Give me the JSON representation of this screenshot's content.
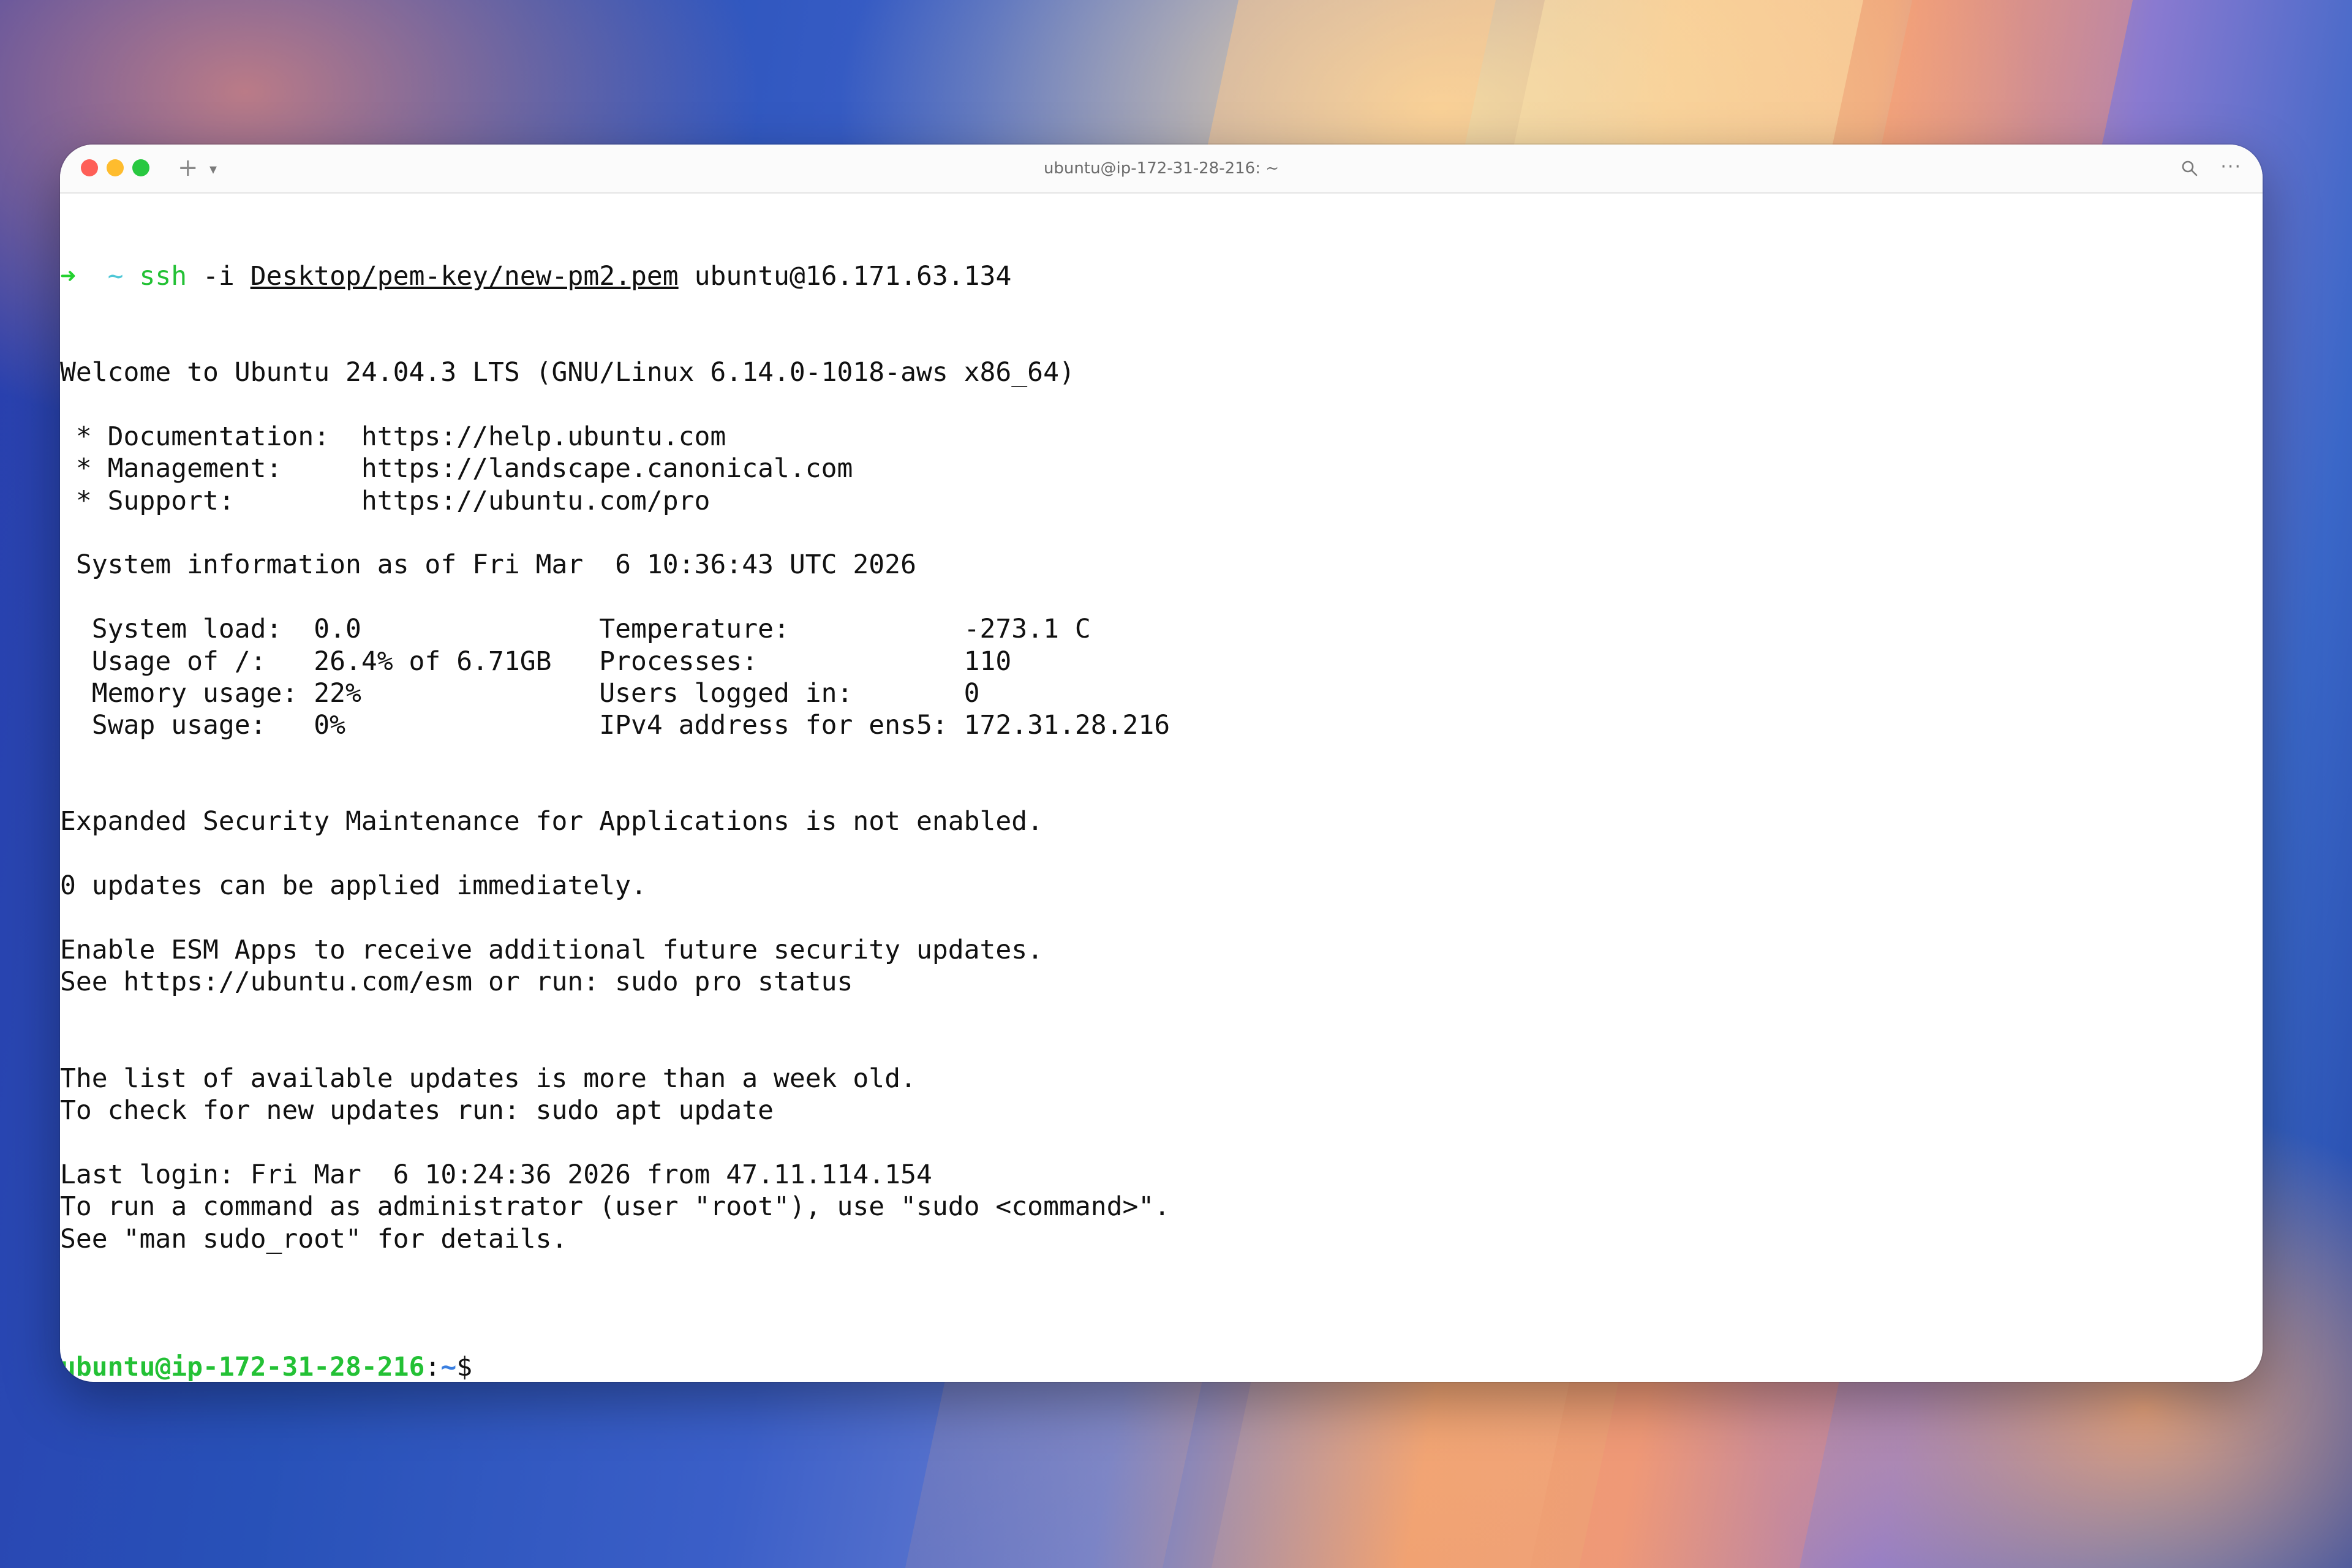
{
  "window": {
    "title": "ubuntu@ip-172-31-28-216: ~",
    "tab_add_glyph": "+",
    "tab_menu_glyph": "▾",
    "more_glyph": "···"
  },
  "icons": {
    "search": "search-icon",
    "more": "more-icon"
  },
  "colors": {
    "prompt_green": "#23c135",
    "path_blue": "#3a7fe0",
    "arrow_green": "#23d12f",
    "tilde_cyan": "#4fc7d6"
  },
  "terminal": {
    "command": {
      "arrow": "➜",
      "dir": "~",
      "program": "ssh",
      "flag": "-i",
      "key_path": "Desktop/pem-key/new-pm2.pem",
      "target": "ubuntu@16.171.63.134"
    },
    "lines": [
      "Welcome to Ubuntu 24.04.3 LTS (GNU/Linux 6.14.0-1018-aws x86_64)",
      "",
      " * Documentation:  https://help.ubuntu.com",
      " * Management:     https://landscape.canonical.com",
      " * Support:        https://ubuntu.com/pro",
      "",
      " System information as of Fri Mar  6 10:36:43 UTC 2026",
      "",
      "  System load:  0.0               Temperature:           -273.1 C",
      "  Usage of /:   26.4% of 6.71GB   Processes:             110",
      "  Memory usage: 22%               Users logged in:       0",
      "  Swap usage:   0%                IPv4 address for ens5: 172.31.28.216",
      "",
      "",
      "Expanded Security Maintenance for Applications is not enabled.",
      "",
      "0 updates can be applied immediately.",
      "",
      "Enable ESM Apps to receive additional future security updates.",
      "See https://ubuntu.com/esm or run: sudo pro status",
      "",
      "",
      "The list of available updates is more than a week old.",
      "To check for new updates run: sudo apt update",
      "",
      "Last login: Fri Mar  6 10:24:36 2026 from 47.11.114.154",
      "To run a command as administrator (user \"root\"), use \"sudo <command>\".",
      "See \"man sudo_root\" for details.",
      ""
    ],
    "prompt": {
      "user_host": "ubuntu@ip-172-31-28-216",
      "separator": ":",
      "path": "~",
      "symbol": "$"
    }
  }
}
